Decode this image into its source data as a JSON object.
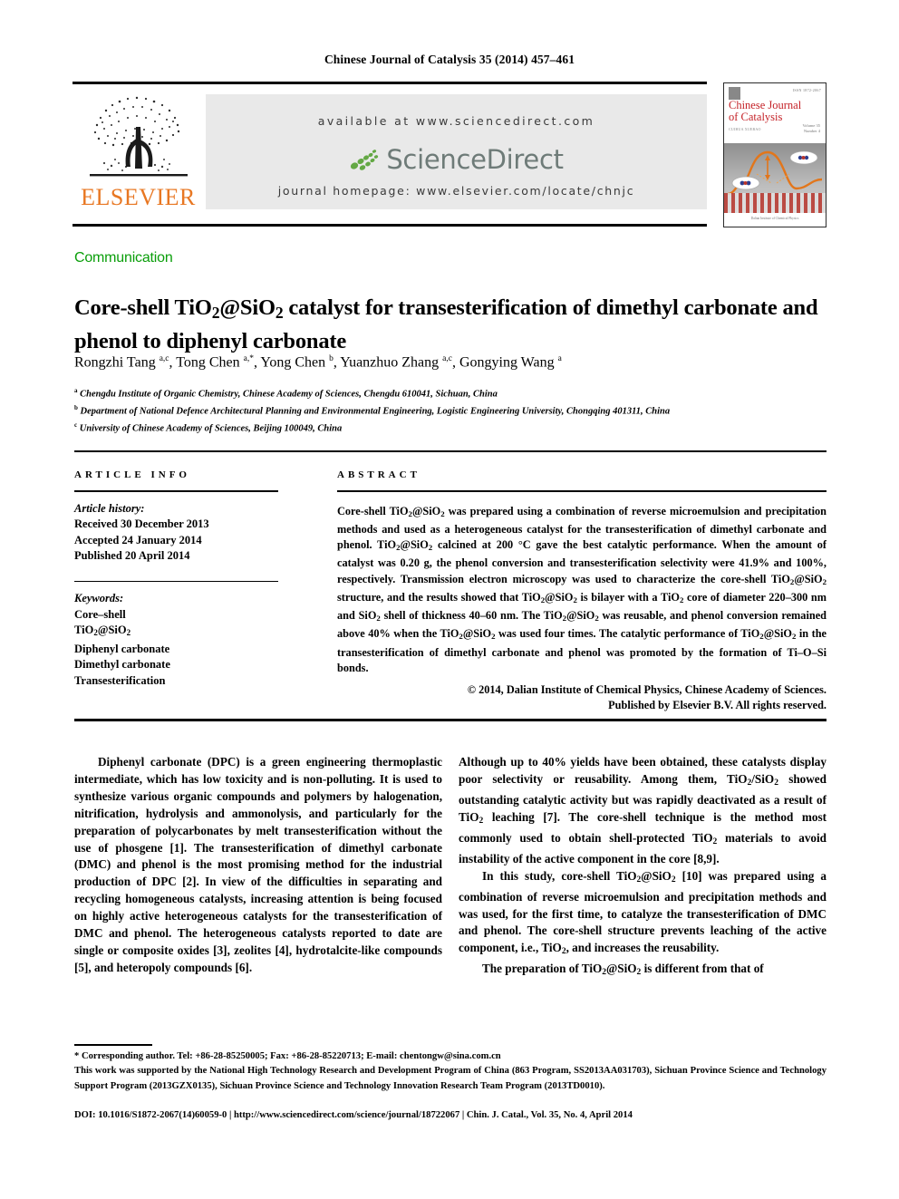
{
  "running_head": "Chinese Journal of Catalysis 35 (2014) 457–461",
  "masthead": {
    "publisher_name": "ELSEVIER",
    "available_at": "available at www.sciencedirect.com",
    "sciencedirect_word": "ScienceDirect",
    "journal_homepage": "journal homepage: www.elsevier.com/locate/chnjc"
  },
  "cover": {
    "title_line1": "Chinese Journal",
    "title_line2": "of Catalysis",
    "issn": "ISSN 1872-2067",
    "subtitle": "CUIHUA XUEBAO",
    "volume": "Volume 35\\nNumber 4",
    "footer": "Dalian Institute of Chemical Physics"
  },
  "article": {
    "type": "Communication",
    "title": "Core-shell TiO2@SiO2 catalyst for transesterification of dimethyl carbonate and phenol to diphenyl carbonate",
    "authors_plain": "Rongzhi Tang a,c, Tong Chen a,*, Yong Chen b, Yuanzhuo Zhang a,c, Gongying Wang a",
    "affiliations": [
      {
        "mark": "a",
        "text": "Chengdu Institute of Organic Chemistry, Chinese Academy of Sciences, Chengdu 610041, Sichuan, China"
      },
      {
        "mark": "b",
        "text": "Department of National Defence Architectural Planning and Environmental Engineering, Logistic Engineering University, Chongqing 401311, China"
      },
      {
        "mark": "c",
        "text": "University of Chinese Academy of Sciences, Beijing 100049, China"
      }
    ]
  },
  "article_info": {
    "heading": "ARTICLE INFO",
    "history_label": "Article history:",
    "history": [
      "Received 30 December 2013",
      "Accepted 24 January 2014",
      "Published 20 April 2014"
    ],
    "keywords_label": "Keywords:",
    "keywords": [
      "Core–shell",
      "TiO2@SiO2",
      "Diphenyl carbonate",
      "Dimethyl carbonate",
      "Transesterification"
    ]
  },
  "abstract": {
    "heading": "ABSTRACT",
    "text": "Core-shell TiO2@SiO2 was prepared using a combination of reverse microemulsion and precipitation methods and used as a heterogeneous catalyst for the transesterification of dimethyl carbonate and phenol. TiO2@SiO2 calcined at 200 °C gave the best catalytic performance. When the amount of catalyst was 0.20 g, the phenol conversion and transesterification selectivity were 41.9% and 100%, respectively. Transmission electron microscopy was used to characterize the core-shell TiO2@SiO2 structure, and the results showed that TiO2@SiO2 is bilayer with a TiO2 core of diameter 220–300 nm and SiO2 shell of thickness 40–60 nm. The TiO2@SiO2 was reusable, and phenol conversion remained above 40% when the TiO2@SiO2 was used four times. The catalytic performance of TiO2@SiO2 in the transesterification of dimethyl carbonate and phenol was promoted by the formation of Ti–O–Si bonds.",
    "copyright_line1": "© 2014, Dalian Institute of Chemical Physics, Chinese Academy of Sciences.",
    "copyright_line2": "Published by Elsevier B.V. All rights reserved."
  },
  "body": {
    "left_paragraphs": [
      "Diphenyl carbonate (DPC) is a green engineering thermoplastic intermediate, which has low toxicity and is non-polluting. It is used to synthesize various organic compounds and polymers by halogenation, nitrification, hydrolysis and ammonolysis, and particularly for the preparation of polycarbonates by melt transesterification without the use of phosgene [1]. The transesterification of dimethyl carbonate (DMC) and phenol is the most promising method for the industrial production of DPC [2]. In view of the difficulties in separating and recycling homogeneous catalysts, increasing attention is being focused on highly active heterogeneous catalysts for the transesterification of DMC and phenol. The heterogeneous catalysts reported to date are single or composite oxides [3], zeolites [4], hydrotalcite-like compounds [5], and heteropoly compounds [6]."
    ],
    "right_paragraphs": [
      "Although up to 40% yields have been obtained, these catalysts display poor selectivity or reusability. Among them, TiO2/SiO2 showed outstanding catalytic activity but was rapidly deactivated as a result of TiO2 leaching [7]. The core-shell technique is the method most commonly used to obtain shell-protected TiO2 materials to avoid instability of the active component in the core [8,9].",
      "In this study, core-shell TiO2@SiO2 [10] was prepared using a combination of reverse microemulsion and precipitation methods and was used, for the first time, to catalyze the transesterification of DMC and phenol. The core-shell structure prevents leaching of the active component, i.e., TiO2, and increases the reusability.",
      "The preparation of TiO2@SiO2 is different from that of"
    ]
  },
  "footnotes": {
    "corresponding": "* Corresponding author. Tel: +86-28-85250005; Fax: +86-28-85220713; E-mail: chentongw@sina.com.cn",
    "funding": "This work was supported by the National High Technology Research and Development Program of China (863 Program, SS2013AA031703), Sichuan Province Science and Technology Support Program (2013GZX0135), Sichuan Province Science and Technology Innovation Research Team Program (2013TD0010).",
    "doi_line": "DOI: 10.1016/S1872-2067(14)60059-0 | http://www.sciencedirect.com/science/journal/18722067 | Chin. J. Catal., Vol. 35, No. 4, April 2014"
  },
  "colors": {
    "elsevier_orange": "#e87722",
    "communication_green": "#0a9e0a",
    "sciencedirect_gray": "#6e7b78",
    "sciencedirect_green": "#63a844",
    "cover_red": "#c42127"
  }
}
